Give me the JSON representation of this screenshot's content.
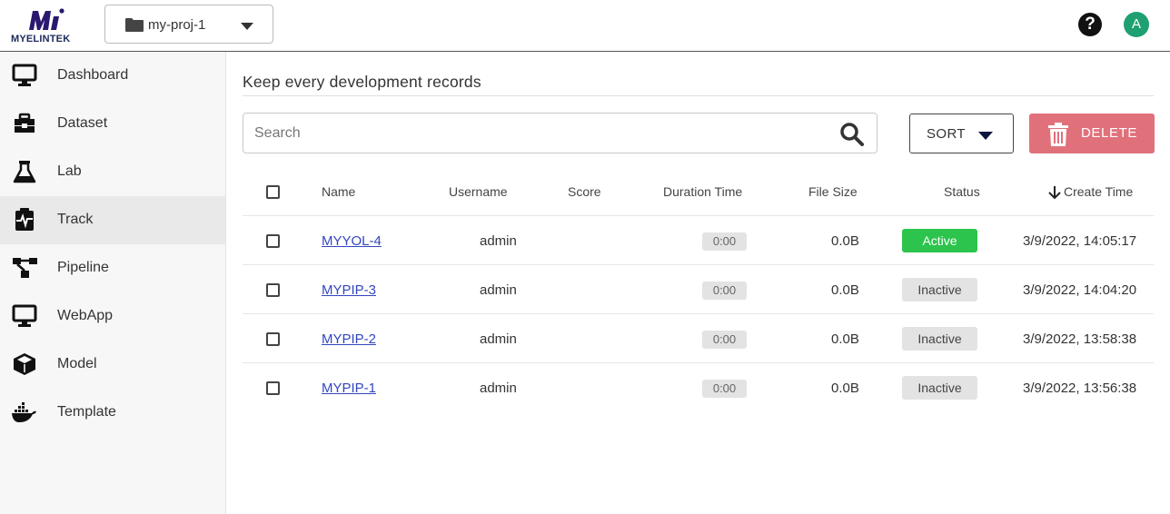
{
  "app": {
    "logo_text": "MYELINTEK",
    "project": "my-proj-1",
    "help_glyph": "?",
    "avatar_initial": "A"
  },
  "colors": {
    "brand": "#1d2a5a",
    "active": "#2cc44c",
    "danger": "#e0717b",
    "link": "#3346c1"
  },
  "sidebar": {
    "items": [
      {
        "label": "Dashboard",
        "icon": "monitor-icon",
        "active": false
      },
      {
        "label": "Dataset",
        "icon": "toolbox-icon",
        "active": false
      },
      {
        "label": "Lab",
        "icon": "flask-icon",
        "active": false
      },
      {
        "label": "Track",
        "icon": "track-icon",
        "active": true
      },
      {
        "label": "Pipeline",
        "icon": "pipeline-icon",
        "active": false
      },
      {
        "label": "WebApp",
        "icon": "monitor-icon",
        "active": false
      },
      {
        "label": "Model",
        "icon": "cube-icon",
        "active": false
      },
      {
        "label": "Template",
        "icon": "docker-icon",
        "active": false
      }
    ]
  },
  "main": {
    "title": "Keep every development records",
    "search": {
      "placeholder": "Search",
      "value": ""
    },
    "sort_label": "SORT",
    "delete_label": "DELETE"
  },
  "table": {
    "headers": {
      "name": "Name",
      "username": "Username",
      "score": "Score",
      "duration": "Duration Time",
      "file_size": "File Size",
      "status": "Status",
      "create_time": "Create Time"
    },
    "sort_column": "create_time",
    "sort_direction": "descending",
    "rows": [
      {
        "name": "MYYOL-4",
        "username": "admin",
        "score": "",
        "duration": "0:00",
        "file_size": "0.0B",
        "status": "Active",
        "create_time": "3/9/2022, 14:05:17"
      },
      {
        "name": "MYPIP-3",
        "username": "admin",
        "score": "",
        "duration": "0:00",
        "file_size": "0.0B",
        "status": "Inactive",
        "create_time": "3/9/2022, 14:04:20"
      },
      {
        "name": "MYPIP-2",
        "username": "admin",
        "score": "",
        "duration": "0:00",
        "file_size": "0.0B",
        "status": "Inactive",
        "create_time": "3/9/2022, 13:58:38"
      },
      {
        "name": "MYPIP-1",
        "username": "admin",
        "score": "",
        "duration": "0:00",
        "file_size": "0.0B",
        "status": "Inactive",
        "create_time": "3/9/2022, 13:56:38"
      }
    ]
  }
}
